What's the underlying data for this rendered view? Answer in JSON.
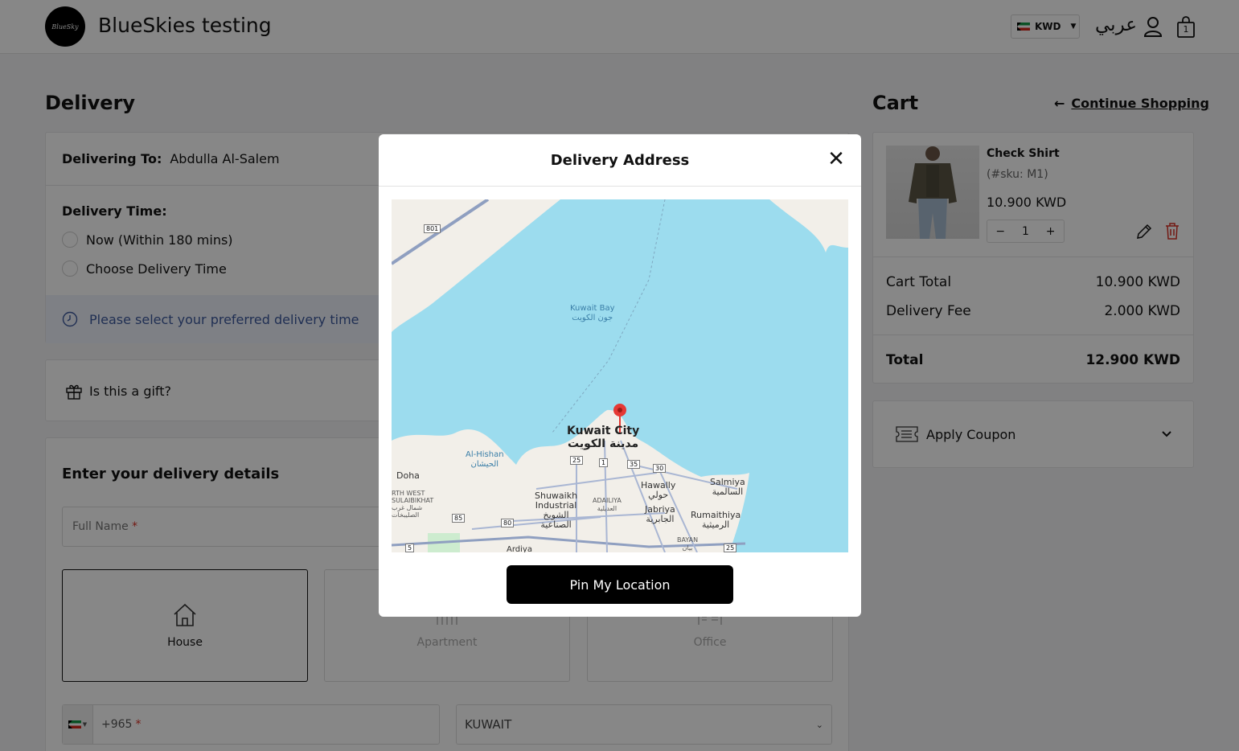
{
  "header": {
    "logo_text": "BlueSky",
    "store_name": "BlueSkies testing",
    "currency": "KWD",
    "language": "عربي",
    "cart_count": "1"
  },
  "delivery": {
    "title": "Delivery",
    "delivering_to_label": "Delivering To:",
    "delivering_to_name": "Abdulla Al-Salem",
    "time_label": "Delivery Time:",
    "option_now": "Now (Within 180 mins)",
    "option_choose": "Choose Delivery Time",
    "notice": "Please select your preferred delivery time",
    "gift_label": "Is this a gift?",
    "details_title": "Enter your delivery details",
    "full_name_placeholder": "Full Name",
    "required_mark": "*",
    "address_types": [
      "House",
      "Apartment",
      "Office"
    ],
    "phone_code": "+965",
    "country": "KUWAIT"
  },
  "cart": {
    "title": "Cart",
    "continue_shopping": "Continue Shopping",
    "item": {
      "name": "Check Shirt",
      "sku": "(#sku: M1)",
      "price": "10.900 KWD",
      "quantity": "1"
    },
    "cart_total_label": "Cart Total",
    "cart_total_value": "10.900 KWD",
    "delivery_fee_label": "Delivery Fee",
    "delivery_fee_value": "2.000 KWD",
    "total_label": "Total",
    "total_value": "12.900 KWD",
    "coupon_label": "Apply Coupon"
  },
  "modal": {
    "title": "Delivery Address",
    "close_symbol": "✕",
    "pin_button": "Pin My Location",
    "map_labels": {
      "kuwait_bay_en": "Kuwait Bay",
      "kuwait_bay_ar": "جون الكويت",
      "kuwait_city_en": "Kuwait City",
      "kuwait_city_ar": "مدينة الكويت",
      "al_hishan_en": "Al-Hishan",
      "al_hishan_ar": "الحيشان",
      "doha": "Doha",
      "north_west_1": "RTH WEST",
      "north_west_2": "SULAIBIKHAT",
      "north_west_3": "شمال غرب",
      "north_west_4": "الصليبخات",
      "shuwaikh_1": "Shuwaikh",
      "shuwaikh_2": "Industrial",
      "shuwaikh_3": "الشويخ",
      "shuwaikh_4": "الصناعية",
      "adailiya_en": "ADAILIYA",
      "adailiya_ar": "العديلية",
      "hawally_en": "Hawally",
      "hawally_ar": "حولي",
      "jabriya_en": "Jabriya",
      "jabriya_ar": "الجابرية",
      "salmiya_en": "Salmiya",
      "salmiya_ar": "السالمية",
      "rumaithiya_en": "Rumaithiya",
      "rumaithiya_ar": "الرميثية",
      "bayan_en": "BAYAN",
      "bayan_ar": "بيان",
      "ardiya": "Ardiya",
      "road_801": "801",
      "road_25a": "25",
      "road_1": "1",
      "road_35": "35",
      "road_30": "30",
      "road_85": "85",
      "road_80": "80",
      "road_5": "5",
      "road_25b": "25"
    }
  },
  "colors": {
    "water": "#9cdcee",
    "land": "#f2efe9",
    "accent": "#000000",
    "delete": "#d93025",
    "notice_bg": "#eef2fb",
    "notice_text": "#3d5a9e",
    "pin": "#e53935"
  }
}
